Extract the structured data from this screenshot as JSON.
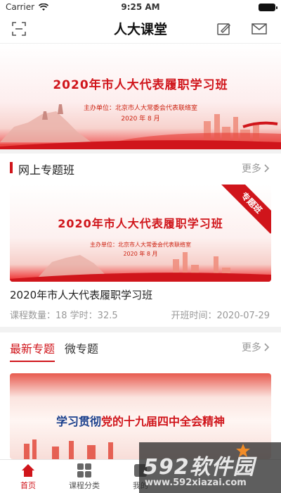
{
  "status_bar": {
    "carrier": "Carrier",
    "time": "9:25 AM",
    "battery_level": 1.0
  },
  "nav": {
    "title": "人大课堂",
    "left_icon": "scan-icon",
    "right_icons": [
      "edit-icon",
      "mail-icon"
    ]
  },
  "hero_banner": {
    "title": "2020年市人大代表履职学习班",
    "organizer": "主办单位：北京市人大常委会代表联络室",
    "date": "2020 年 8 月"
  },
  "online_section": {
    "title": "网上专题班",
    "more": "更多",
    "ribbon": "专题班",
    "banner_title": "2020年市人大代表履职学习班",
    "banner_organizer": "主办单位：北京市人大常委会代表联络室",
    "banner_date": "2020 年 8 月",
    "course_name": "2020年市人大代表履职学习班",
    "course_meta": "课程数量：18 学时：32.5",
    "open_time": "开班时间：2020-07-29"
  },
  "topics_section": {
    "tabs": [
      "最新专题",
      "微专题"
    ],
    "active_tab": "最新专题",
    "more": "更多",
    "banner_title_prefix": "学习贯彻",
    "banner_title_highlight": "党的十九届四中全会精神"
  },
  "tab_bar": [
    {
      "label": "首页",
      "icon": "home-icon",
      "active": true
    },
    {
      "label": "课程分类",
      "icon": "grid-icon",
      "active": false
    },
    {
      "label": "我的",
      "icon": "profile-icon",
      "active": false
    }
  ],
  "watermark": {
    "brand": "592软件园",
    "url": "www.592xiazai.com"
  },
  "colors": {
    "accent": "#d0151b",
    "text": "#333333",
    "muted": "#999999"
  }
}
